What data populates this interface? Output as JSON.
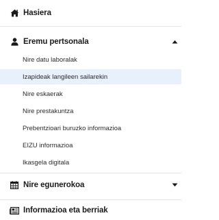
{
  "menu": {
    "home": {
      "label": "Hasiera",
      "icon": "home-icon"
    },
    "personal": {
      "label": "Eremu pertsonala",
      "icon": "user-icon",
      "expanded": true,
      "items": [
        {
          "label": "Nire datu laboralak"
        },
        {
          "label": "Izapideak langileen sailarekin",
          "active": true
        },
        {
          "label": "Nire eskaerak"
        },
        {
          "label": "Nire prestakuntza"
        },
        {
          "label": "Prebentzioari buruzko informazioa"
        },
        {
          "label": "EIZU informazioa"
        },
        {
          "label": "Ikasgela digitala"
        }
      ]
    },
    "agenda": {
      "label": "Nire egunerokoa",
      "icon": "calendar-icon",
      "expanded": false
    },
    "news": {
      "label": "Informazioa eta berriak",
      "icon": "newspaper-icon"
    }
  },
  "colors": {
    "active_bg": "#e8f1fb",
    "text": "#1b1b1b",
    "divider": "#e3e3e3"
  }
}
